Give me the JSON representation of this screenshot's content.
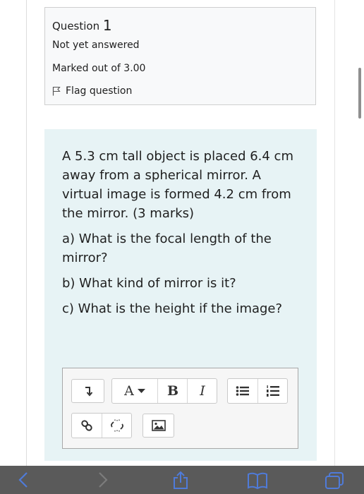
{
  "question_info": {
    "label": "Question",
    "number": "1",
    "state": "Not yet answered",
    "grade": "Marked out of 3.00",
    "flag_label": "Flag question"
  },
  "question": {
    "paragraphs": [
      "A 5.3 cm tall object is placed 6.4 cm away from a spherical mirror. A virtual image is formed 4.2 cm from the mirror. (3 marks)",
      "a) What is the focal length of the mirror?",
      "b) What kind of mirror is it?",
      "c) What is the height if the image?"
    ]
  },
  "editor_toolbar": {
    "font_color_label": "A",
    "bold_label": "B",
    "italic_label": "I",
    "icons": [
      "expand-toolbar-icon",
      "font-color-icon",
      "bold-icon",
      "italic-icon",
      "unordered-list-icon",
      "ordered-list-icon",
      "link-icon",
      "unlink-icon",
      "image-icon"
    ]
  },
  "browser_bar": {
    "icons": [
      "back-arrow-icon",
      "forward-arrow-icon",
      "share-icon",
      "bookmarks-icon",
      "tabs-icon"
    ]
  },
  "colors": {
    "info_bg": "#f8f9fa",
    "formulation_bg": "#e7f3f5",
    "toolbar_bg": "#5a5a5a",
    "toolbar_accent": "#4f7bd9"
  }
}
